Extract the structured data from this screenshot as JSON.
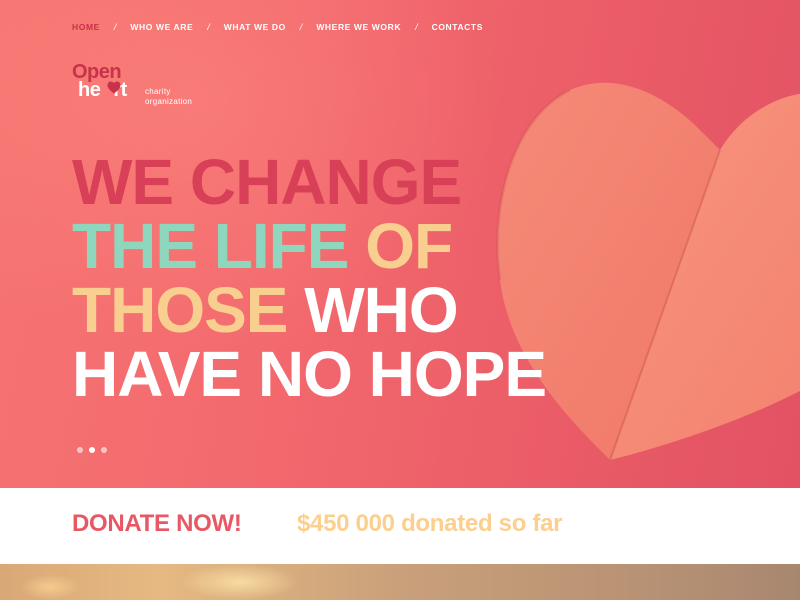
{
  "nav": {
    "items": [
      {
        "label": "HOME",
        "active": true
      },
      {
        "label": "WHO WE ARE",
        "active": false
      },
      {
        "label": "WHAT WE DO",
        "active": false
      },
      {
        "label": "WHERE WE WORK",
        "active": false
      },
      {
        "label": "CONTACTS",
        "active": false
      }
    ],
    "separator": "/"
  },
  "logo": {
    "line1": "Open",
    "line2": "he",
    "line2_end": "rt",
    "tagline_1": "charity",
    "tagline_2": "organization",
    "icon": "heart-icon"
  },
  "hero": {
    "line1": "WE CHANGE",
    "line2_a": "THE LIFE",
    "line2_b": "OF",
    "line3_a": "THOSE",
    "line3_b": "WHO",
    "line4": "HAVE NO HOPE",
    "slides": 3,
    "active_slide": 1
  },
  "donate": {
    "button_label": "DONATE NOW!",
    "stat_text": "$450 000 donated so far"
  },
  "colors": {
    "brand_red": "#c8324a",
    "hero_pink": "#f36a6e",
    "mint": "#8fd6be",
    "sand": "#f9cf90",
    "donate_red": "#e85864",
    "donate_gold": "#fbcf8e"
  }
}
